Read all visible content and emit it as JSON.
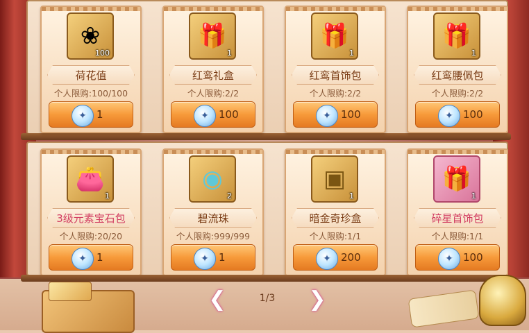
{
  "items": [
    {
      "name": "荷花值",
      "icon": "lotus-icon",
      "glyph": "❀",
      "quantity": "100",
      "limit": "个人限购:100/100",
      "price": "1",
      "name_color": "#7b3d16",
      "frame": "gold"
    },
    {
      "name": "红鸾礼盒",
      "icon": "gift-box-dice-icon",
      "glyph": "🎁",
      "quantity": "1",
      "limit": "个人限购:2/2",
      "price": "100",
      "name_color": "#7b3d16",
      "frame": "gold"
    },
    {
      "name": "红鸾首饰包",
      "icon": "gift-box-dice-icon",
      "glyph": "🎁",
      "quantity": "1",
      "limit": "个人限购:2/2",
      "price": "100",
      "name_color": "#7b3d16",
      "frame": "gold"
    },
    {
      "name": "红鸾腰佩包",
      "icon": "gift-box-dice-icon",
      "glyph": "🎁",
      "quantity": "1",
      "limit": "个人限购:2/2",
      "price": "100",
      "name_color": "#7b3d16",
      "frame": "gold"
    },
    {
      "name": "3级元素宝石包",
      "icon": "gem-pouch-icon",
      "glyph": "👛",
      "quantity": "1",
      "limit": "个人限购:20/20",
      "price": "1",
      "name_color": "#d23f63",
      "frame": "gold"
    },
    {
      "name": "碧流珠",
      "icon": "jade-orb-icon",
      "glyph": "◉",
      "quantity": "2",
      "limit": "个人限购:999/999",
      "price": "1",
      "name_color": "#7b3d16",
      "frame": "gold"
    },
    {
      "name": "暗金奇珍盒",
      "icon": "golden-chest-icon",
      "glyph": "▣",
      "quantity": "1",
      "limit": "个人限购:1/1",
      "price": "200",
      "name_color": "#7b3d16",
      "frame": "gold"
    },
    {
      "name": "碎星首饰包",
      "icon": "star-jewel-box-icon",
      "glyph": "🎁",
      "quantity": "1",
      "limit": "个人限购:1/1",
      "price": "100",
      "name_color": "#d23f63",
      "frame": "pink"
    }
  ],
  "currency_icon": "dragon-mask-coin-icon",
  "pager": {
    "current": "1/3"
  },
  "colors": {
    "accent": "#f79a3a",
    "pink_name": "#d23f63",
    "brown_name": "#7b3d16"
  }
}
